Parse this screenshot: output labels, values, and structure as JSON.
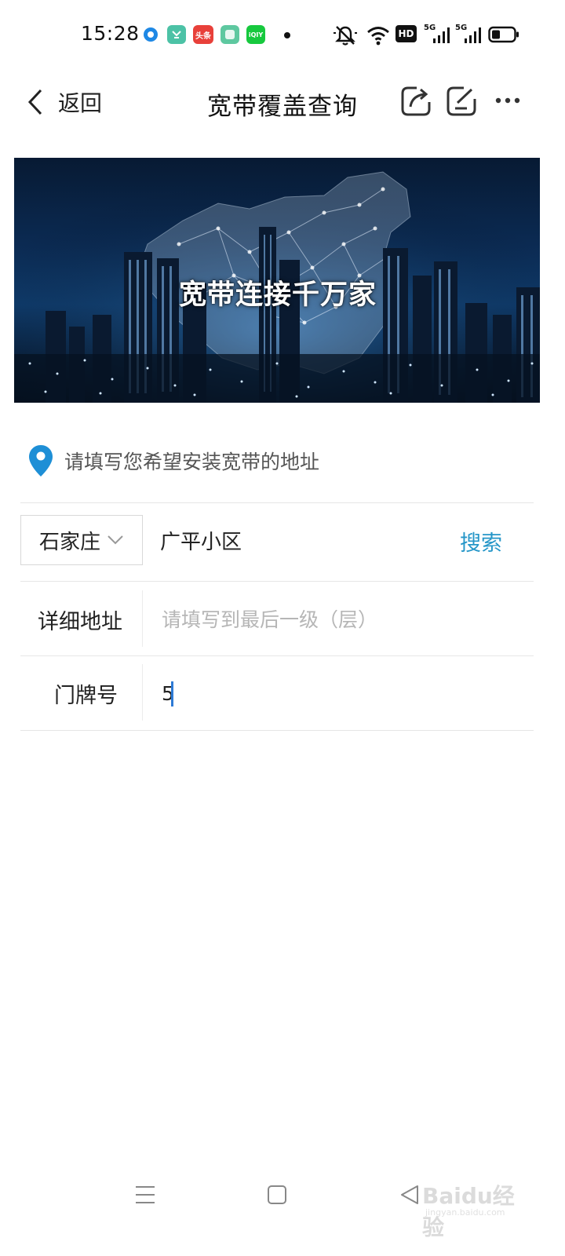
{
  "status_bar": {
    "time": "15:28",
    "notification_icons": [
      "browser-icon",
      "taobao-icon",
      "toutiao-icon",
      "app-icon",
      "iqiyi-icon"
    ],
    "toutiao_text": "头条",
    "iqiyi_text": "iQIY",
    "right_icons": [
      "mute-icon",
      "wifi-icon",
      "hd-icon",
      "5g-signal-icon",
      "5g-signal-icon",
      "battery-icon"
    ],
    "hd_text": "HD",
    "network_label": "5G"
  },
  "nav": {
    "back_label": "返回",
    "title": "宽带覆盖查询",
    "icons": [
      "share-icon",
      "edit-icon",
      "more-icon"
    ]
  },
  "banner": {
    "caption": "宽带连接千万家"
  },
  "form": {
    "hint": "请填写您希望安装宽带的地址",
    "city": "石家庄",
    "search_value": "广平小区",
    "search_button": "搜索",
    "detail_label": "详细地址",
    "detail_placeholder": "请填写到最后一级（层）",
    "door_label": "门牌号",
    "door_value": "5"
  },
  "colors": {
    "accent": "#2596c8",
    "pin": "#1e8fd6",
    "caret": "#2e7bd6"
  },
  "watermark": {
    "brand": "Baidu经验",
    "url": "jingyan.baidu.com"
  }
}
